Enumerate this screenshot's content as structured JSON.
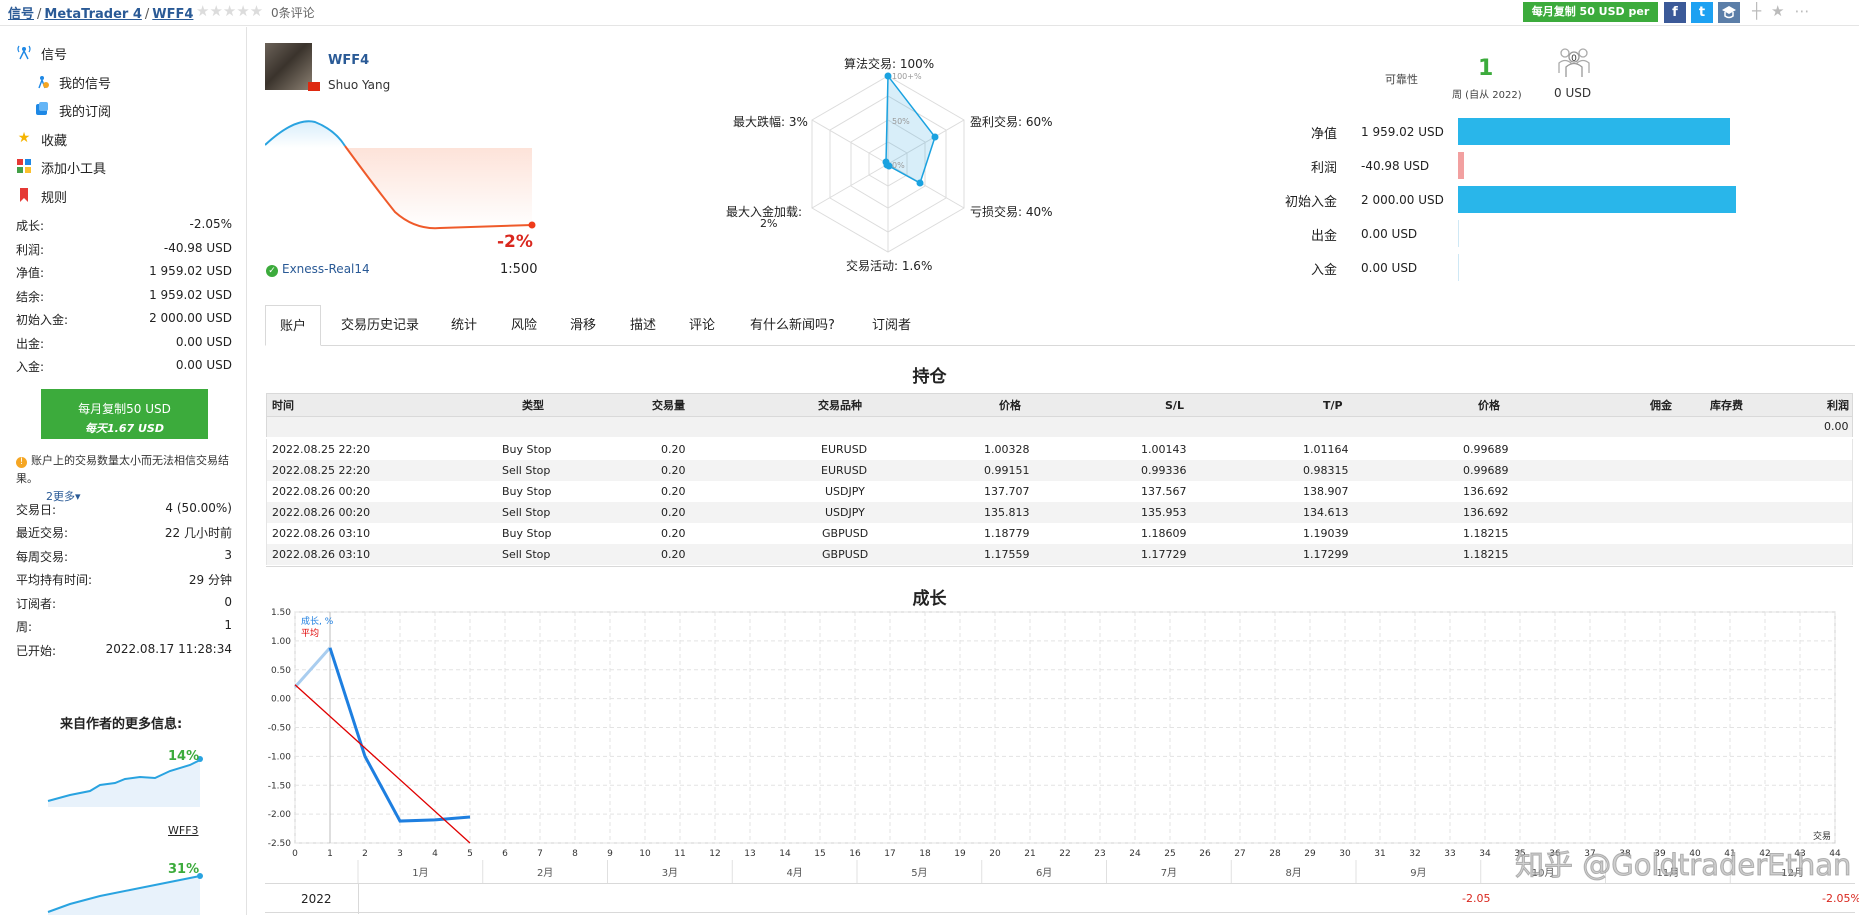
{
  "breadcrumb": {
    "signals": "信号",
    "platform": "MetaTrader 4",
    "signal": "WFF4"
  },
  "rating": {
    "stars": "★★★★★",
    "reviews": "0条评论"
  },
  "top_copy_button": "每月复制 50 USD per",
  "social": {
    "facebook": "f",
    "twitter": "t",
    "other": "⬛"
  },
  "sidebar": {
    "nav": [
      {
        "label": "信号",
        "icon": "antenna-icon"
      },
      {
        "label": "我的信号",
        "icon": "my-signals-icon"
      },
      {
        "label": "我的订阅",
        "icon": "subscriptions-icon"
      },
      {
        "label": "收藏",
        "icon": "star-icon"
      },
      {
        "label": "添加小工具",
        "icon": "widget-icon"
      },
      {
        "label": "规则",
        "icon": "bookmark-icon"
      }
    ],
    "stats": [
      {
        "k": "成长:",
        "v": "-2.05%"
      },
      {
        "k": "利润:",
        "v": "-40.98 USD"
      },
      {
        "k": "净值:",
        "v": "1 959.02 USD"
      },
      {
        "k": "结余:",
        "v": "1 959.02 USD"
      },
      {
        "k": "初始入金:",
        "v": "2 000.00 USD"
      },
      {
        "k": "出金:",
        "v": "0.00 USD"
      },
      {
        "k": "入金:",
        "v": "0.00 USD"
      }
    ],
    "copy_line1": "每月复制50 USD",
    "copy_line2": "每天1.67 USD",
    "warning": "账户上的交易数量太小而无法相信交易结果。",
    "more": "2更多▾",
    "stats2": [
      {
        "k": "交易日:",
        "v": "4 (50.00%)"
      },
      {
        "k": "最近交易:",
        "v": "22 几小时前"
      },
      {
        "k": "每周交易:",
        "v": "3"
      },
      {
        "k": "平均持有时间:",
        "v": "29 分钟"
      },
      {
        "k": "订阅者:",
        "v": "0"
      },
      {
        "k": "周:",
        "v": "1"
      },
      {
        "k": "已开始:",
        "v": "2022.08.17 11:28:34"
      }
    ],
    "more_title": "来自作者的更多信息:",
    "other_signals": [
      {
        "name": "WFF3",
        "growth": "14%"
      },
      {
        "name": "",
        "growth": "31%"
      }
    ]
  },
  "header": {
    "name": "WFF4",
    "author": "Shuo Yang",
    "growth": "-2%",
    "broker": "Exness-Real14",
    "leverage": "1:500"
  },
  "radar": {
    "algo": "算法交易: 100%",
    "profit_trades": "盈利交易: 60%",
    "loss_trades": "亏损交易: 40%",
    "activity": "交易活动: 1.6%",
    "max_deposit_load_1": "最大入金加载:",
    "max_deposit_load_2": "2%",
    "max_drawdown": "最大跌幅: 3%",
    "r100": "100+%",
    "r50": "50%",
    "r0": "0%"
  },
  "reliability": {
    "label": "可靠性",
    "weeks": "1",
    "weeks_label": "周 (自从 2022)",
    "subs_count": "0",
    "subs_usd": "0 USD"
  },
  "balance_bars": [
    {
      "k": "净值",
      "v": "1 959.02 USD",
      "fraction": 0.9795,
      "color": "#29b6ea"
    },
    {
      "k": "利润",
      "v": "-40.98 USD",
      "fraction": 0.0205,
      "color": "#f2a0a0"
    },
    {
      "k": "初始入金",
      "v": "2 000.00 USD",
      "fraction": 1.0,
      "color": "#29b6ea"
    },
    {
      "k": "出金",
      "v": "0.00 USD",
      "fraction": 0,
      "color": "#29b6ea"
    },
    {
      "k": "入金",
      "v": "0.00 USD",
      "fraction": 0,
      "color": "#29b6ea"
    }
  ],
  "tabs": [
    "账户",
    "交易历史记录",
    "统计",
    "风险",
    "滑移",
    "描述",
    "评论",
    "有什么新闻吗?",
    "订阅者"
  ],
  "positions": {
    "title": "持仓",
    "headers": [
      "时间",
      "类型",
      "交易量",
      "交易品种",
      "价格",
      "S/L",
      "T/P",
      "价格",
      "佣金",
      "库存费",
      "利润"
    ],
    "total_profit": "0.00",
    "rows": [
      [
        "2022.08.25 22:20",
        "Buy Stop",
        "0.20",
        "EURUSD",
        "1.00328",
        "1.00143",
        "1.01164",
        "0.99689"
      ],
      [
        "2022.08.25 22:20",
        "Sell Stop",
        "0.20",
        "EURUSD",
        "0.99151",
        "0.99336",
        "0.98315",
        "0.99689"
      ],
      [
        "2022.08.26 00:20",
        "Buy Stop",
        "0.20",
        "USDJPY",
        "137.707",
        "137.567",
        "138.907",
        "136.692"
      ],
      [
        "2022.08.26 00:20",
        "Sell Stop",
        "0.20",
        "USDJPY",
        "135.813",
        "135.953",
        "134.613",
        "136.692"
      ],
      [
        "2022.08.26 03:10",
        "Buy Stop",
        "0.20",
        "GBPUSD",
        "1.18779",
        "1.18609",
        "1.19039",
        "1.18215"
      ],
      [
        "2022.08.26 03:10",
        "Sell Stop",
        "0.20",
        "GBPUSD",
        "1.17559",
        "1.17729",
        "1.17299",
        "1.18215"
      ]
    ]
  },
  "growth": {
    "title": "成长",
    "legend_growth": "成长, %",
    "legend_avg": "平均",
    "x_axis_label": "交易",
    "year": "2022",
    "aug_value": "-2.05",
    "total_value": "-2.05%"
  },
  "chart_data": [
    {
      "type": "line",
      "title": "成长",
      "xlabel": "交易",
      "ylabel": "",
      "xlim": [
        0,
        44
      ],
      "ylim": [
        -2.5,
        1.5
      ],
      "x_ticks": [
        0,
        1,
        2,
        3,
        4,
        5,
        6,
        7,
        8,
        9,
        10,
        11,
        12,
        13,
        14,
        15,
        16,
        17,
        18,
        19,
        20,
        21,
        22,
        23,
        24,
        25,
        26,
        27,
        28,
        29,
        30,
        31,
        32,
        33,
        34,
        35,
        36,
        37,
        38,
        39,
        40,
        41,
        42,
        43,
        44
      ],
      "y_ticks": [
        "1.50",
        "1.00",
        "0.50",
        "0.00",
        "-0.50",
        "-1.00",
        "-1.50",
        "-2.00",
        "-2.50"
      ],
      "months": [
        "1月",
        "2月",
        "3月",
        "4月",
        "5月",
        "6月",
        "7月",
        "8月",
        "9月",
        "10月",
        "11月",
        "12月"
      ],
      "series": [
        {
          "name": "成长, %",
          "x": [
            0,
            1,
            2,
            3,
            4,
            5
          ],
          "y": [
            0.2,
            0.88,
            -1.0,
            -2.12,
            -2.1,
            -2.05
          ],
          "color": "#1e7fe0"
        },
        {
          "name": "平均",
          "x": [
            0,
            5
          ],
          "y": [
            0.24,
            -2.5
          ],
          "color": "#e00000"
        }
      ]
    },
    {
      "type": "area",
      "title": "",
      "series": [
        {
          "name": "",
          "values": [
            0,
            1,
            -1.5,
            -2.05
          ]
        }
      ]
    }
  ]
}
